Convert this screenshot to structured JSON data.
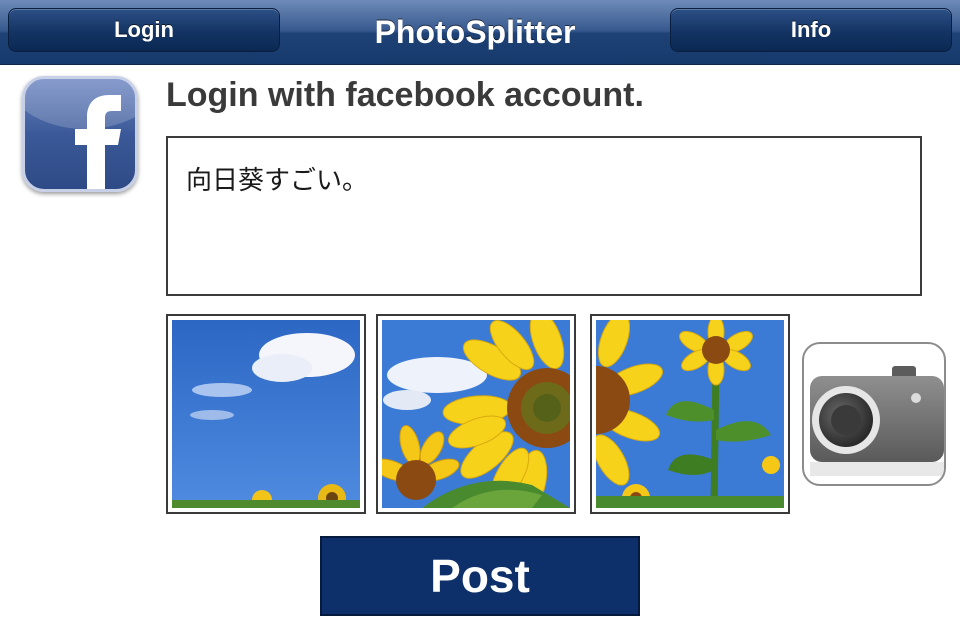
{
  "navbar": {
    "title": "PhotoSplitter",
    "left_button_label": "Login",
    "right_button_label": "Info",
    "color": "#1f4276"
  },
  "main": {
    "heading": "Login with facebook account.",
    "message_text": "向日葵すごい。",
    "thumbnails": [
      {
        "icon": "photo-sky-thumbnail"
      },
      {
        "icon": "photo-sunflower-thumbnail"
      },
      {
        "icon": "photo-sunflower-stem-thumbnail"
      }
    ],
    "camera_icon": "camera-icon",
    "facebook_icon": "facebook-logo-icon",
    "post_button_label": "Post",
    "post_button_color": "#0d2f6a"
  }
}
